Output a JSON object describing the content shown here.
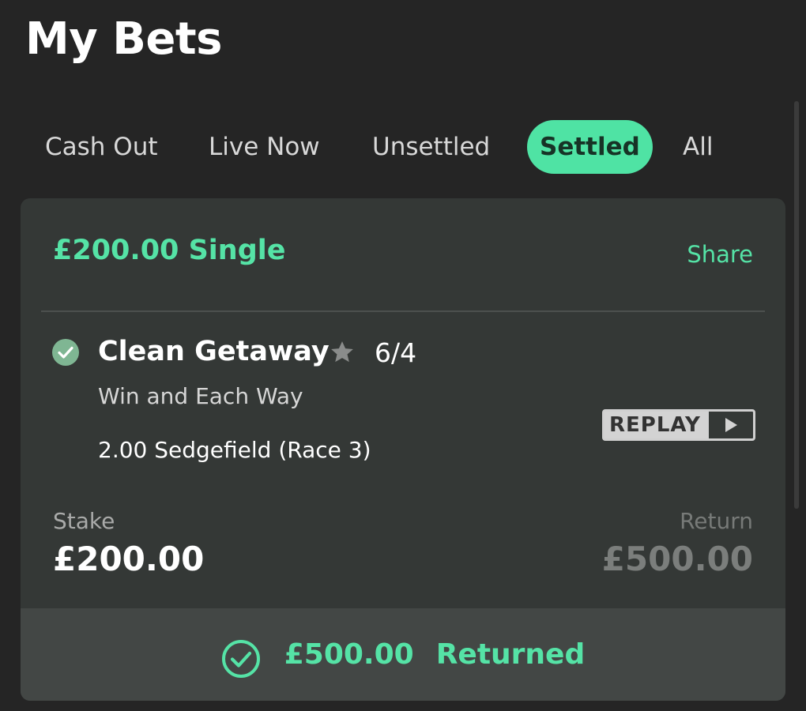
{
  "header": {
    "title": "My Bets"
  },
  "tabs": [
    {
      "label": "Cash Out",
      "active": false
    },
    {
      "label": "Live Now",
      "active": false
    },
    {
      "label": "Unsettled",
      "active": false
    },
    {
      "label": "Settled",
      "active": true
    },
    {
      "label": "All",
      "active": false
    }
  ],
  "bet": {
    "title": "£200.00 Single",
    "share_label": "Share",
    "selection": {
      "name": "Clean Getaway",
      "odds": "6/4",
      "market": "Win and Each Way",
      "event": "2.00 Sedgefield (Race 3)",
      "status_icon": "check-circle-icon",
      "favourite_icon": "star-icon"
    },
    "replay_label": "REPLAY",
    "stake_label": "Stake",
    "stake_value": "£200.00",
    "return_label": "Return",
    "return_value": "£500.00",
    "footer": {
      "amount": "£500.00",
      "status": "Returned"
    }
  },
  "colors": {
    "accent": "#55e3a6",
    "background": "#252525",
    "card": "#343836",
    "footer": "#434745"
  }
}
